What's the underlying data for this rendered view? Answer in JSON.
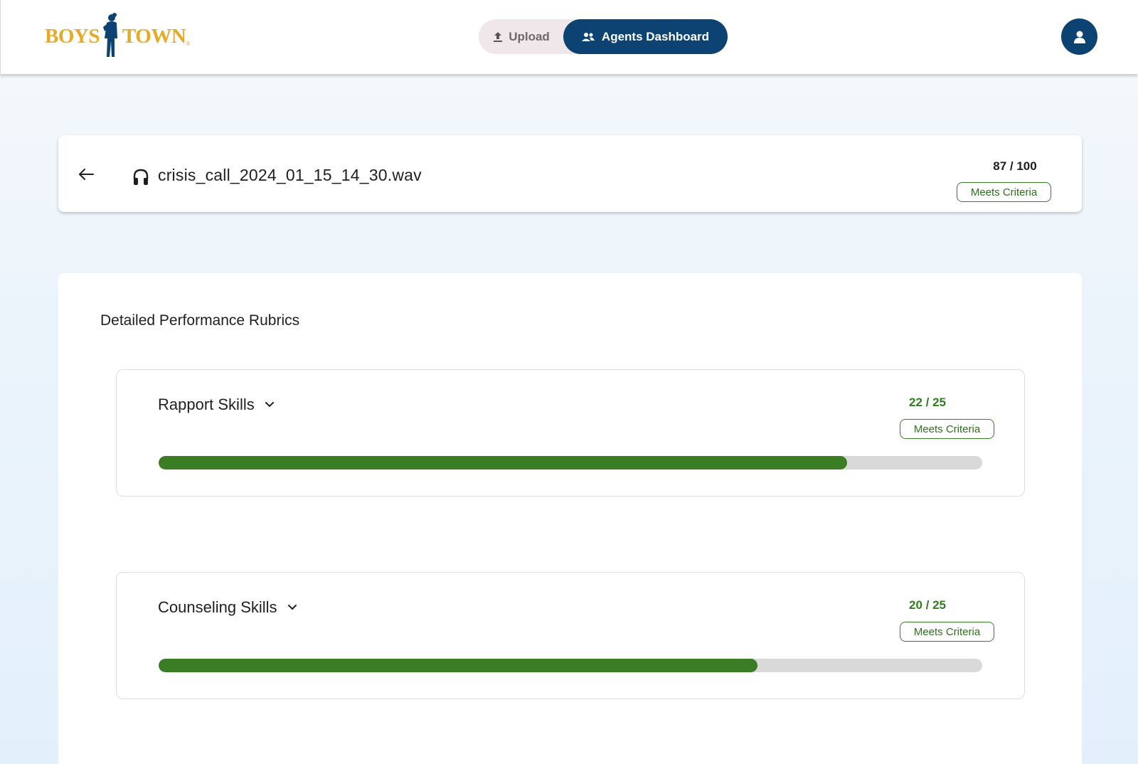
{
  "header": {
    "logo": {
      "left_text": "BOYS",
      "right_text": "TOWN",
      "reg_mark": "®"
    },
    "nav": {
      "upload_label": "Upload",
      "agents_dashboard_label": "Agents Dashboard",
      "active": "Agents Dashboard"
    },
    "user_icon": "user-icon"
  },
  "call": {
    "file_name": "crisis_call_2024_01_15_14_30.wav",
    "total_score": "87 / 100",
    "status": "Meets Criteria"
  },
  "rubrics": {
    "title": "Detailed Performance Rubrics",
    "items": [
      {
        "name": "Rapport Skills",
        "score": "22 / 25",
        "status": "Meets Criteria",
        "progress": 0.836
      },
      {
        "name": "Counseling Skills",
        "score": "20 / 25",
        "status": "Meets Criteria",
        "progress": 0.727
      }
    ]
  },
  "colors": {
    "brand_navy": "#0d4373",
    "brand_gold": "#e6a92a",
    "success_green": "#3a7d25",
    "track_gray": "#d9d9d9"
  }
}
